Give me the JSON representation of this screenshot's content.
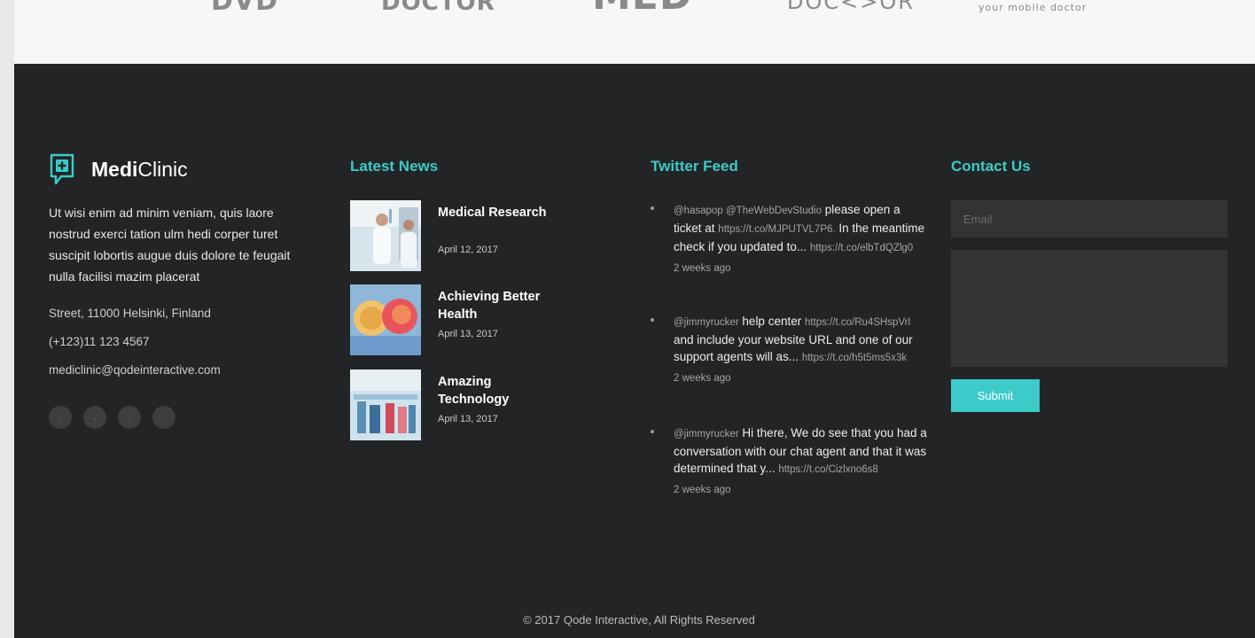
{
  "logos": [
    {
      "text": "DVD",
      "icon": "partner-logo"
    },
    {
      "text": "DOCTOR",
      "icon": "partner-logo"
    },
    {
      "text": "MED",
      "icon": "partner-logo"
    },
    {
      "text": "DOC<>OR",
      "icon": "partner-logo"
    },
    {
      "text": "your mobile doctor",
      "icon": "partner-logo"
    }
  ],
  "about": {
    "brand_strong": "Medi",
    "brand_rest": "Clinic",
    "description": "Ut wisi enim ad minim veniam, quis laore nostrud exerci tation ulm hedi corper turet suscipit lobortis augue duis dolore te feugait nulla facilisi mazim placerat",
    "address": "Street, 11000 Helsinki, Finland",
    "phone": "(+123)11 123 4567",
    "email": "mediclinic@qodeinteractive.com",
    "socials": [
      ".",
      ",",
      ":",
      ""
    ]
  },
  "news": {
    "title": "Latest News",
    "items": [
      {
        "title": "Medical Research",
        "date": "April 12, 2017"
      },
      {
        "title": "Achieving Better Health",
        "date": "April 13, 2017"
      },
      {
        "title": "Amazing Technology",
        "date": "April 13, 2017"
      }
    ]
  },
  "twitter": {
    "title": "Twitter Feed",
    "tweets": [
      {
        "handle": "@hasapop @TheWebDevStudio",
        "text": "please open a ticket at",
        "link1": "https://t.co/MJPUTVL7P6.",
        "text2": "In the meantime check if you updated to...",
        "link2": "https://t.co/elbTdQZlg0",
        "time": "2 weeks ago"
      },
      {
        "handle": "@jimmyrucker",
        "text": "help center",
        "link1": "https://t.co/Ru4SHspVrl",
        "text2": "and include your website URL and one of our support agents will as...",
        "link2": "https://t.co/h5t5ms5x3k",
        "time": "2 weeks ago"
      },
      {
        "handle": "@jimmyrucker",
        "text": "Hi there, We do see that you had a conversation with our chat agent and that it was determined that y...",
        "link1": "https://t.co/Cizlxno6s8",
        "text2": "",
        "link2": "",
        "time": "2 weeks ago"
      }
    ]
  },
  "contact": {
    "title": "Contact Us",
    "email_placeholder": "Email",
    "message_placeholder": "",
    "submit_label": "Submit"
  },
  "footer": {
    "copyright": "© 2017 Qode Interactive, All Rights Reserved"
  },
  "colors": {
    "accent": "#3ccbc9",
    "footer_bg": "#232425",
    "logo_band_bg": "#f7f7f7"
  }
}
